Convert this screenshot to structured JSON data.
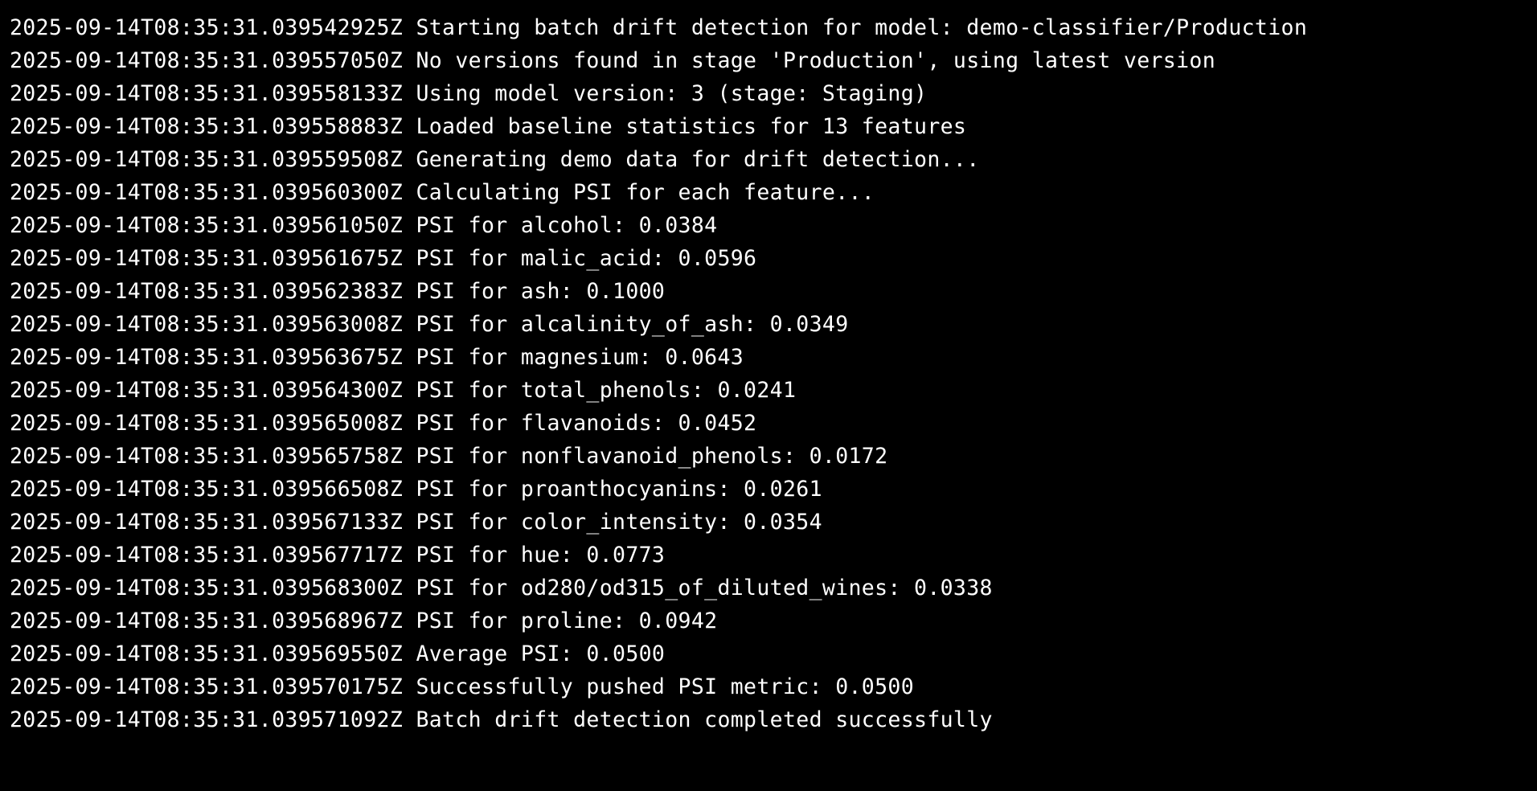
{
  "terminal": {
    "background": "#000000",
    "text_color": "#ffffff",
    "lines": [
      {
        "timestamp": "2025-09-14T08:35:31.039542925Z",
        "message": "Starting batch drift detection for model: demo-classifier/Production"
      },
      {
        "timestamp": "2025-09-14T08:35:31.039557050Z",
        "message": "No versions found in stage 'Production', using latest version"
      },
      {
        "timestamp": "2025-09-14T08:35:31.039558133Z",
        "message": "Using model version: 3 (stage: Staging)"
      },
      {
        "timestamp": "2025-09-14T08:35:31.039558883Z",
        "message": "Loaded baseline statistics for 13 features"
      },
      {
        "timestamp": "2025-09-14T08:35:31.039559508Z",
        "message": "Generating demo data for drift detection..."
      },
      {
        "timestamp": "2025-09-14T08:35:31.039560300Z",
        "message": "Calculating PSI for each feature..."
      },
      {
        "timestamp": "2025-09-14T08:35:31.039561050Z",
        "message": "PSI for alcohol: 0.0384"
      },
      {
        "timestamp": "2025-09-14T08:35:31.039561675Z",
        "message": "PSI for malic_acid: 0.0596"
      },
      {
        "timestamp": "2025-09-14T08:35:31.039562383Z",
        "message": "PSI for ash: 0.1000"
      },
      {
        "timestamp": "2025-09-14T08:35:31.039563008Z",
        "message": "PSI for alcalinity_of_ash: 0.0349"
      },
      {
        "timestamp": "2025-09-14T08:35:31.039563675Z",
        "message": "PSI for magnesium: 0.0643"
      },
      {
        "timestamp": "2025-09-14T08:35:31.039564300Z",
        "message": "PSI for total_phenols: 0.0241"
      },
      {
        "timestamp": "2025-09-14T08:35:31.039565008Z",
        "message": "PSI for flavanoids: 0.0452"
      },
      {
        "timestamp": "2025-09-14T08:35:31.039565758Z",
        "message": "PSI for nonflavanoid_phenols: 0.0172"
      },
      {
        "timestamp": "2025-09-14T08:35:31.039566508Z",
        "message": "PSI for proanthocyanins: 0.0261"
      },
      {
        "timestamp": "2025-09-14T08:35:31.039567133Z",
        "message": "PSI for color_intensity: 0.0354"
      },
      {
        "timestamp": "2025-09-14T08:35:31.039567717Z",
        "message": "PSI for hue: 0.0773"
      },
      {
        "timestamp": "2025-09-14T08:35:31.039568300Z",
        "message": "PSI for od280/od315_of_diluted_wines: 0.0338"
      },
      {
        "timestamp": "2025-09-14T08:35:31.039568967Z",
        "message": "PSI for proline: 0.0942"
      },
      {
        "timestamp": "2025-09-14T08:35:31.039569550Z",
        "message": "Average PSI: 0.0500"
      },
      {
        "timestamp": "2025-09-14T08:35:31.039570175Z",
        "message": "Successfully pushed PSI metric: 0.0500"
      },
      {
        "timestamp": "2025-09-14T08:35:31.039571092Z",
        "message": "Batch drift detection completed successfully"
      }
    ]
  }
}
